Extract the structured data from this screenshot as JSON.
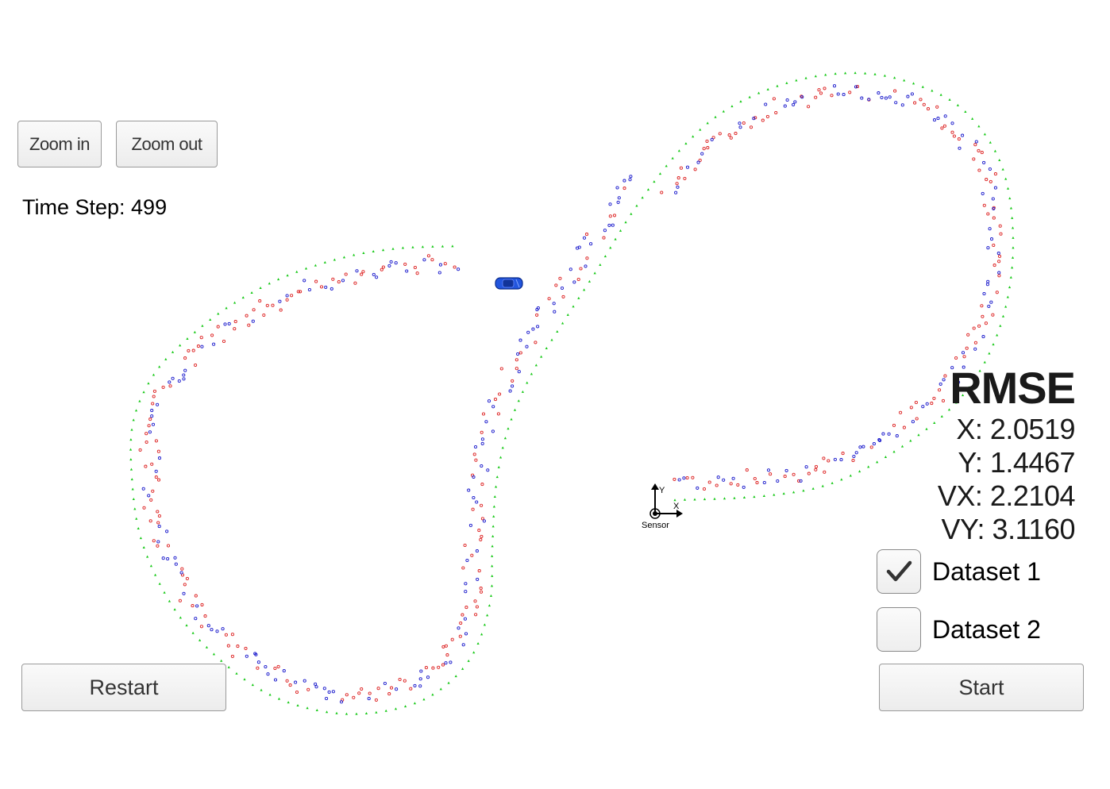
{
  "toolbar": {
    "zoom_in_label": "Zoom in",
    "zoom_out_label": "Zoom out"
  },
  "status": {
    "time_step_label": "Time Step: 499"
  },
  "rmse": {
    "title": "RMSE",
    "x": "X: 2.0519",
    "y": "Y: 1.4467",
    "vx": "VX: 2.2104",
    "vy": "VY: 3.1160"
  },
  "datasets": [
    {
      "label": "Dataset 1",
      "checked": true
    },
    {
      "label": "Dataset 2",
      "checked": false
    }
  ],
  "controls": {
    "restart_label": "Restart",
    "start_label": "Start"
  },
  "sensor": {
    "label": "Sensor",
    "x_axis": "X",
    "y_axis": "Y"
  },
  "colors": {
    "ground_truth": "#14c814",
    "lidar": "#dd2222",
    "radar": "#1a1acc",
    "car": "#2255dd"
  },
  "icons": {
    "checkbox_checked": "checkmark-icon",
    "car": "car-icon",
    "sensor": "sensor-origin-icon"
  }
}
